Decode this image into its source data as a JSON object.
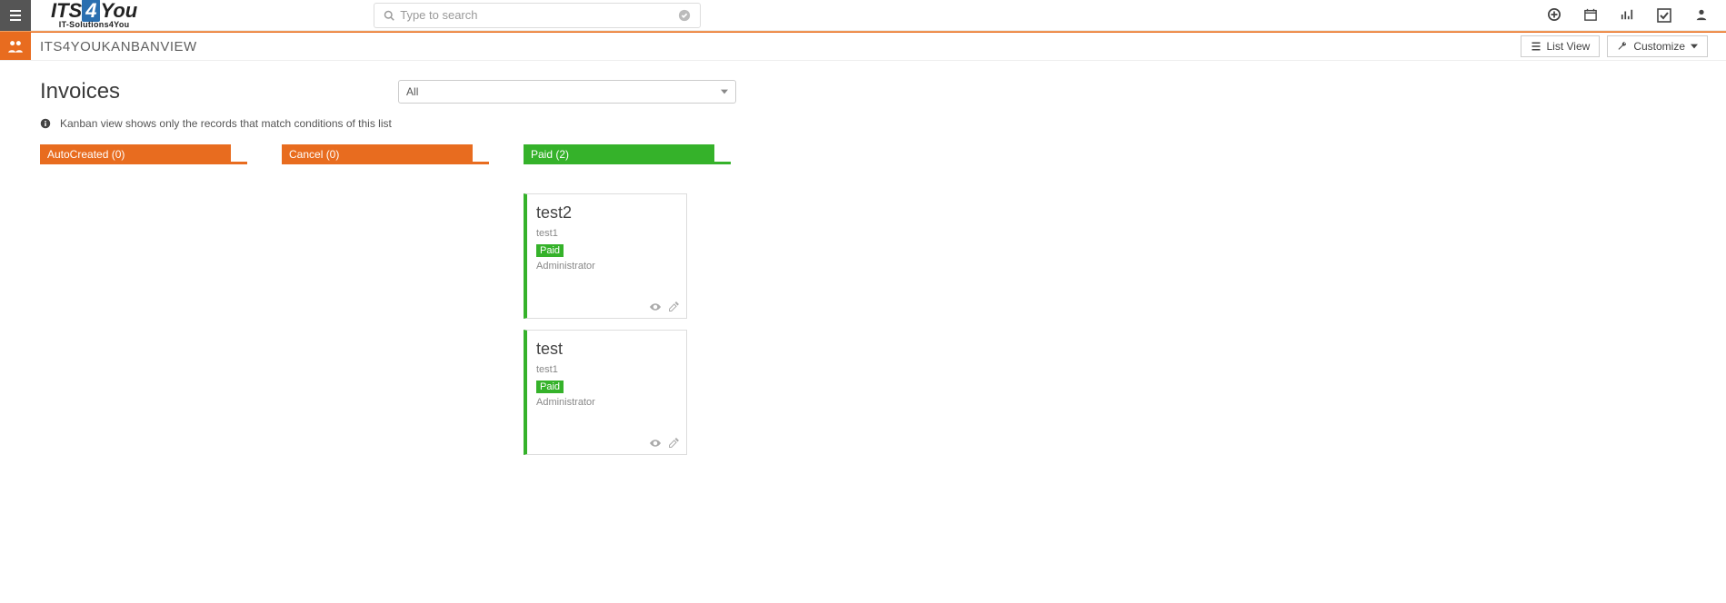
{
  "logo": {
    "left": "ITS",
    "mid": "4",
    "right": "You",
    "sub": "IT-Solutions4You"
  },
  "breadcrumb": "ITS4YOUKANBANVIEW",
  "search": {
    "placeholder": "Type to search"
  },
  "buttons": {
    "listview": "List View",
    "customize": "Customize"
  },
  "page": {
    "title": "Invoices",
    "filter_value": "All",
    "info_text": "Kanban view shows only the records that match conditions of this list"
  },
  "columns": [
    {
      "label": "AutoCreated (0)",
      "color": "orange",
      "cards": []
    },
    {
      "label": "Cancel (0)",
      "color": "orange",
      "cards": []
    },
    {
      "label": "Paid (2)",
      "color": "green",
      "cards": [
        {
          "title": "test2",
          "sub": "test1",
          "status": "Paid",
          "owner": "Administrator"
        },
        {
          "title": "test",
          "sub": "test1",
          "status": "Paid",
          "owner": "Administrator"
        }
      ]
    }
  ],
  "icons": {
    "menu": "menu-icon",
    "search": "search-icon",
    "tick": "tick-circle-icon",
    "plus": "plus-circle-icon",
    "calendar": "calendar-icon",
    "stats": "barchart-icon",
    "check": "checkbox-icon",
    "user": "user-icon",
    "group": "group-icon",
    "info": "info-circle-icon",
    "list": "list-icon",
    "wrench": "wrench-icon",
    "caret": "caret-down-icon",
    "dd": "dropdown-caret-icon",
    "eye": "eye-icon",
    "edit": "edit-icon"
  }
}
